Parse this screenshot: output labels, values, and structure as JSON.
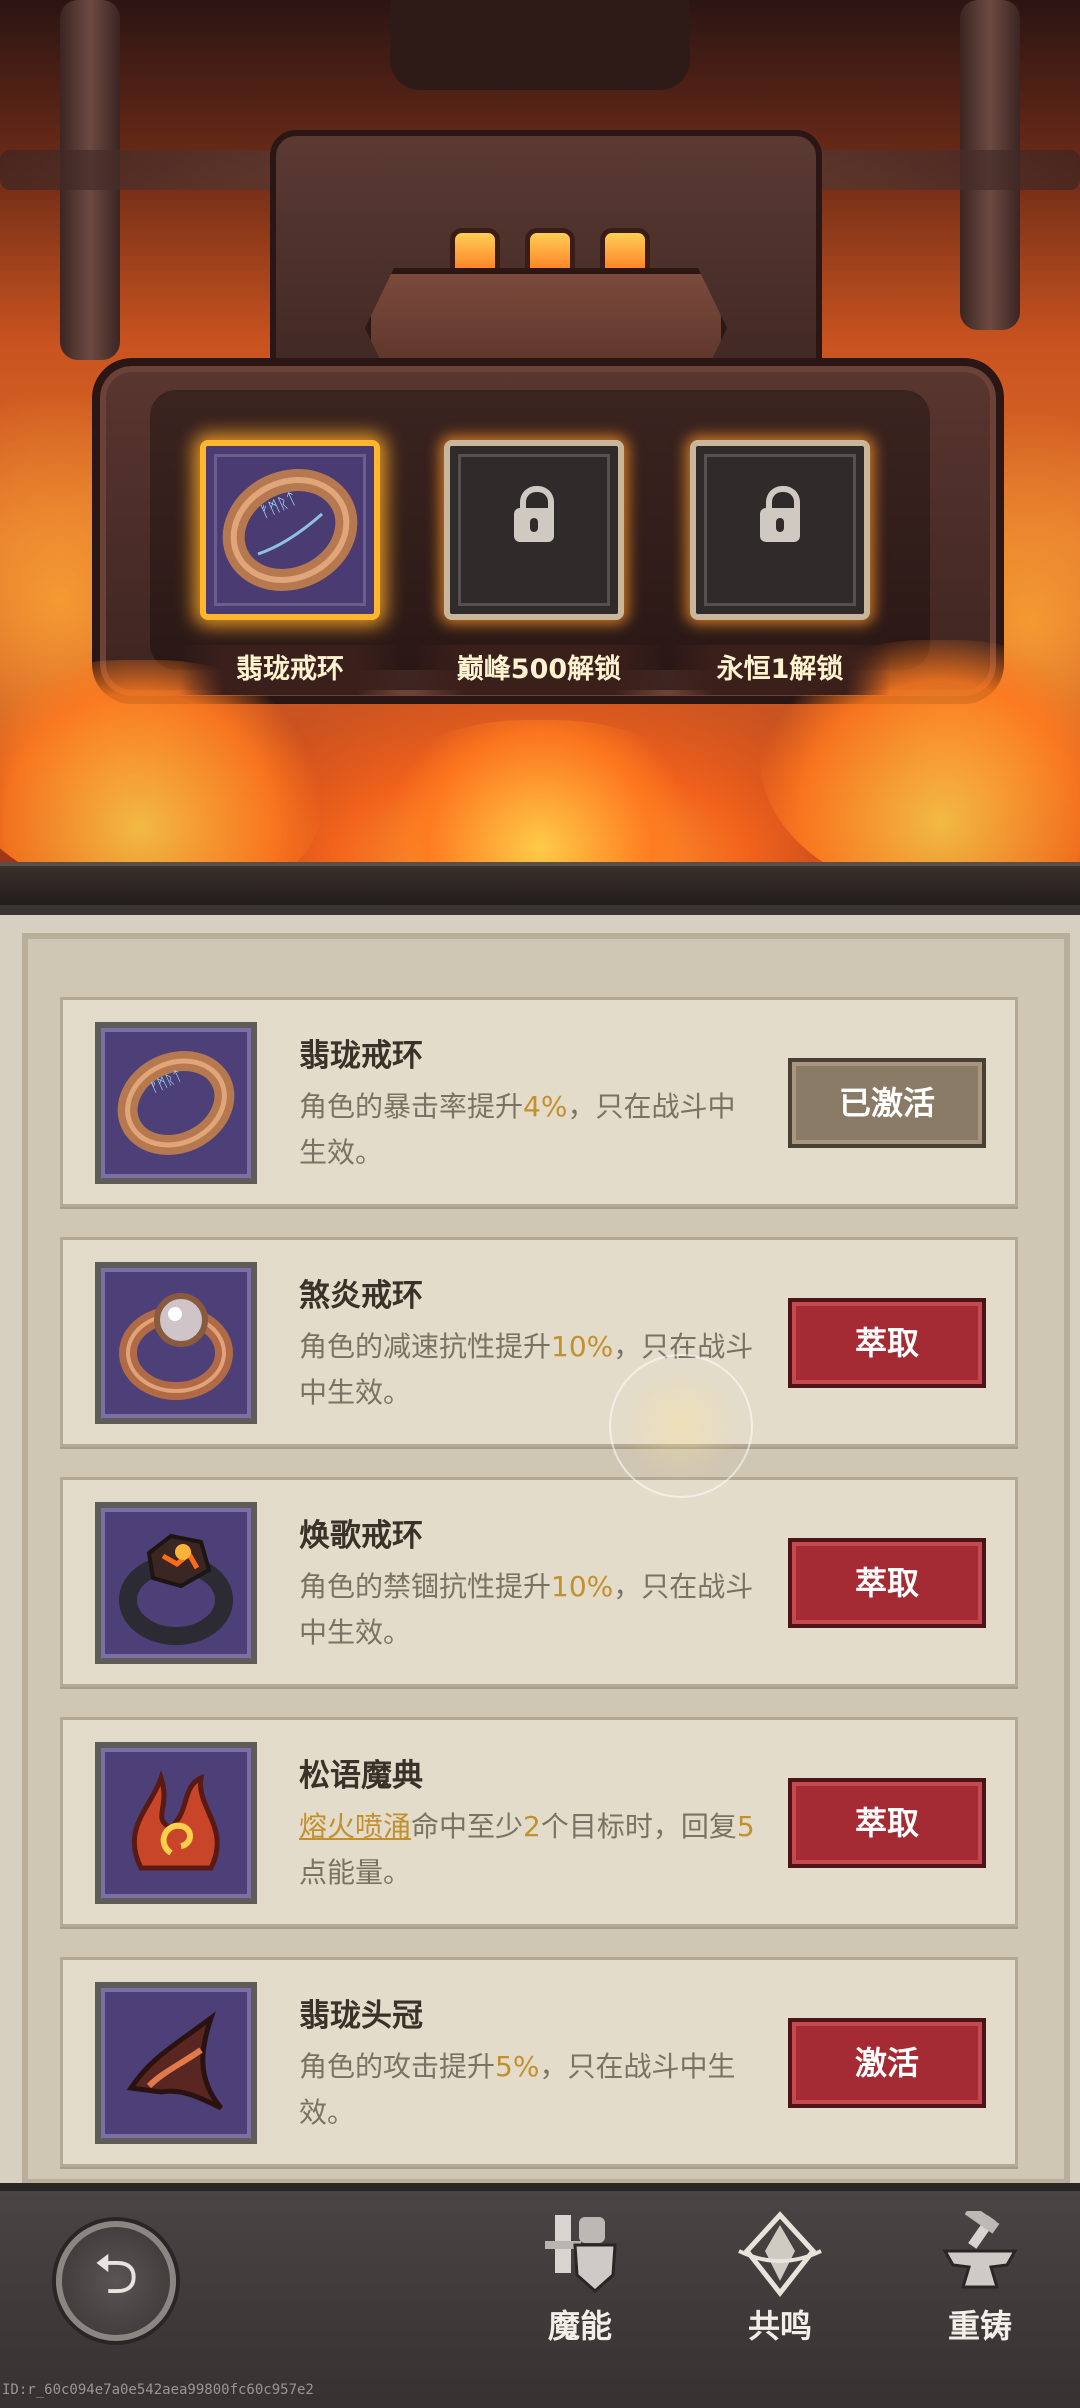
{
  "slots": [
    {
      "label": "翡珑戒环",
      "state": "active",
      "icon": "rune-ring-icon"
    },
    {
      "label": "巅峰500解锁",
      "state": "locked",
      "icon": "lock-icon"
    },
    {
      "label": "永恒1解锁",
      "state": "locked",
      "icon": "lock-icon"
    }
  ],
  "items": [
    {
      "name": "翡珑戒环",
      "desc": [
        "角色的暴击率提升",
        "4%",
        "，只在战斗中生效。"
      ],
      "button": "已激活",
      "button_state": "activated",
      "icon": "rune-ring-icon"
    },
    {
      "name": "煞炎戒环",
      "desc": [
        "角色的减速抗性提升",
        "10%",
        "，只在战斗中生效。"
      ],
      "button": "萃取",
      "button_state": "extract",
      "icon": "pearl-ring-icon"
    },
    {
      "name": "焕歌戒环",
      "desc": [
        "角色的禁锢抗性提升",
        "10%",
        "，只在战斗中生效。"
      ],
      "button": "萃取",
      "button_state": "extract",
      "icon": "lava-ring-icon"
    },
    {
      "name": "松语魔典",
      "desc": [
        "熔火喷涌",
        "命中至少",
        "2",
        "个目标时，回复",
        "5",
        "点能量。"
      ],
      "button": "萃取",
      "button_state": "extract",
      "icon": "flame-tome-icon"
    },
    {
      "name": "翡珑头冠",
      "desc": [
        "角色的攻击提升",
        "5%",
        "，只在战斗中生效。"
      ],
      "button": "激活",
      "button_state": "activate",
      "icon": "horn-crown-icon"
    }
  ],
  "nav": {
    "back_glyph": "⮌",
    "items": [
      {
        "label": "魔能",
        "icon": "knight-icon"
      },
      {
        "label": "共鸣",
        "icon": "crystal-icon"
      },
      {
        "label": "重铸",
        "icon": "anvil-icon"
      }
    ]
  },
  "footer_id": "ID:r_60c094e7a0e542aea99800fc60c957e2",
  "colors": {
    "highlight": "#c2902c",
    "button_red": "#a42a33",
    "button_done": "#8a7b67",
    "slot_glow": "#ffb62e"
  }
}
